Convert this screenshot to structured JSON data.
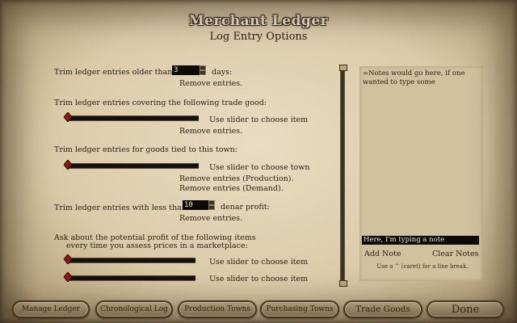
{
  "header": {
    "title": "Merchant Ledger",
    "subtitle": "Log Entry Options"
  },
  "options": {
    "trim_older": {
      "label": "Trim ledger entries older than:",
      "value": "3",
      "suffix": "days:",
      "action": "Remove entries."
    },
    "trim_good": {
      "label": "Trim ledger entries covering the following trade good:",
      "slider_hint": "Use slider to choose item",
      "action": "Remove entries."
    },
    "trim_town": {
      "label": "Trim ledger entries for goods tied to this town:",
      "slider_hint": "Use slider to choose town",
      "action_production": "Remove entries (Production).",
      "action_demand": "Remove entries (Demand)."
    },
    "trim_profit": {
      "label": "Trim ledger entries with less than:",
      "value": "10",
      "suffix": "denar profit:",
      "action": "Remove entries."
    },
    "ask_profit": {
      "line1": "Ask about the potential profit of the following items",
      "line2": "every time you assess prices in a marketplace:",
      "slider1_hint": "Use slider to choose item",
      "slider2_hint": "Use slider to choose item"
    }
  },
  "notes": {
    "text": "=Notes would go here, if one wanted to type some",
    "input_value": "Here, I'm typing a note",
    "add_label": "Add Note",
    "clear_label": "Clear Notes",
    "hint": "Use a ^ (caret) for a line break."
  },
  "buttons": {
    "manage": "Manage Ledger",
    "chrono": "Chronological Log",
    "production": "Production Towns",
    "purchasing": "Purchasing Towns",
    "trade_goods": "Trade Goods",
    "done": "Done"
  },
  "colors": {
    "parchment": "#e9dcc3",
    "ink": "#2b2116",
    "slider": "#15120e",
    "thumb": "#8b1a12"
  }
}
